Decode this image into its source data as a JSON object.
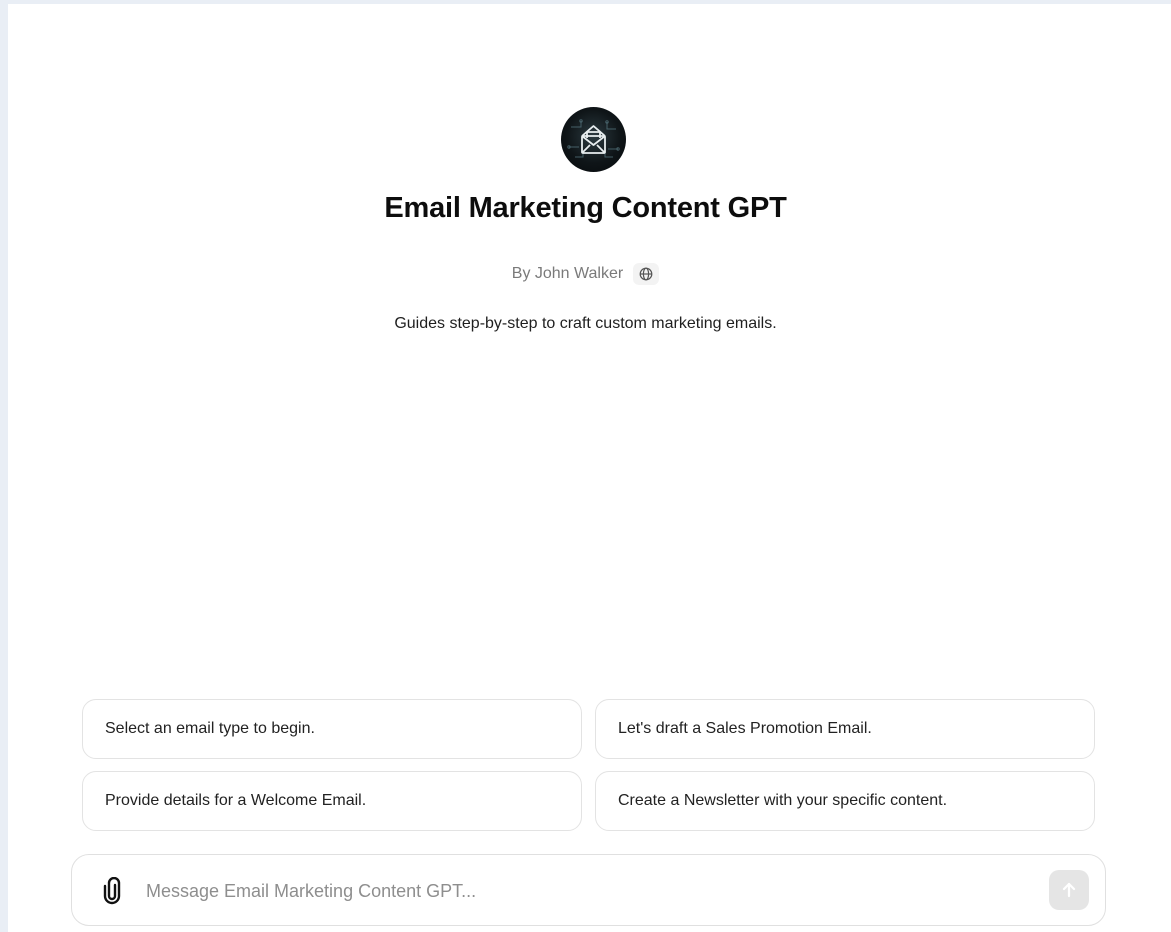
{
  "gpt": {
    "name": "Email Marketing Content GPT",
    "author": "By John Walker",
    "description": "Guides step-by-step to craft custom marketing emails.",
    "avatar_icon": "envelope-circuit-logo",
    "author_icon": "globe-icon"
  },
  "suggestions": [
    {
      "label": "Select an email type to begin."
    },
    {
      "label": "Let's draft a Sales Promotion Email."
    },
    {
      "label": "Provide details for a Welcome Email."
    },
    {
      "label": "Create a Newsletter with your specific content."
    }
  ],
  "composer": {
    "placeholder": "Message Email Marketing Content GPT...",
    "value": "",
    "attach_icon": "paperclip-icon",
    "send_icon": "arrow-up-icon"
  },
  "colors": {
    "page_edge": "#e9eef5",
    "background": "#ffffff",
    "send_disabled": "#e5e5e5",
    "border": "#e3e3e3"
  }
}
